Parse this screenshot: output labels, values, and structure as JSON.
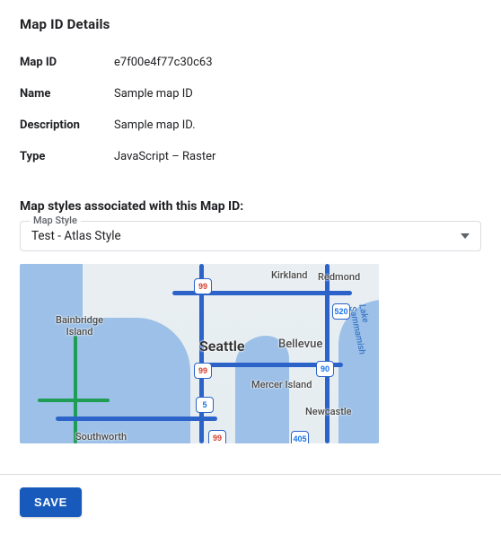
{
  "header": {
    "title": "Map ID Details"
  },
  "details": {
    "map_id": {
      "label": "Map ID",
      "value": "e7f00e4f77c30c63"
    },
    "name": {
      "label": "Name",
      "value": "Sample map ID"
    },
    "desc": {
      "label": "Description",
      "value": "Sample map ID."
    },
    "type": {
      "label": "Type",
      "value": "JavaScript – Raster"
    }
  },
  "styles_section": {
    "title": "Map styles associated with this Map ID:",
    "select": {
      "floating_label": "Map Style",
      "value": "Test - Atlas Style"
    }
  },
  "map": {
    "city_big": "Seattle",
    "labels": {
      "bainbridge": "Bainbridge\nIsland",
      "kirkland": "Kirkland",
      "redmond": "Redmond",
      "bellevue": "Bellevue",
      "mercer": "Mercer Island",
      "newcastle": "Newcastle",
      "southworth": "Southworth",
      "lake": "Lake Sammamish"
    },
    "shields": {
      "s1": "99",
      "s2": "99",
      "s3": "520",
      "s4": "90",
      "s5": "99",
      "s6": "405",
      "s7": "5"
    }
  },
  "footer": {
    "save_label": "SAVE"
  }
}
